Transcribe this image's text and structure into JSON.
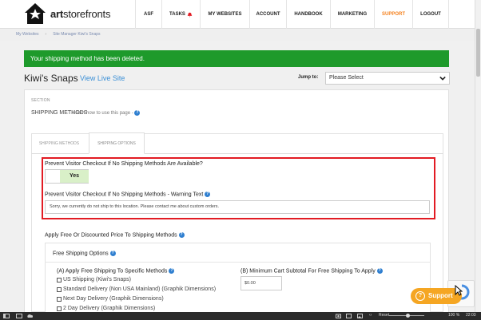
{
  "header": {
    "logo_bold": "art",
    "logo_rest": "storefronts",
    "nav": [
      "ASF",
      "TASKS",
      "MY WEBSITES",
      "ACCOUNT",
      "HANDBOOK",
      "MARKETING",
      "SUPPORT",
      "LOGOUT"
    ]
  },
  "breadcrumb": [
    "My Websites",
    "Site Manager Kiwi's Snaps"
  ],
  "alert": "Your shipping method has been deleted.",
  "site": {
    "title": "Kiwi's Snaps",
    "view_live": "View Live Site",
    "jump_label": "Jump to:",
    "jump_value": "Please Select"
  },
  "section": {
    "label": "SECTION",
    "title": "SHIPPING METHODS",
    "learn": "Learn how to use this page -"
  },
  "tabs": [
    "SHIPPING METHODS",
    "SHIPPING OPTIONS"
  ],
  "prevent": {
    "question": "Prevent Visitor Checkout If No Shipping Methods Are Available?",
    "toggle_value": "Yes",
    "warning_label": "Prevent Visitor Checkout If No Shipping Methods - Warning Text",
    "warning_text": "Sorry, we currently do not ship to this location.  Please contact me about custom orders."
  },
  "apply": {
    "title": "Apply Free Or Discounted Price To Shipping Methods",
    "free_title": "Free Shipping Options",
    "col_a": "(A) Apply Free Shipping To Specific Methods",
    "col_b": "(B) Minimum Cart Subtotal For Free Shipping To Apply",
    "subtotal_value": "$0.00",
    "methods": [
      "US Shipping (Kiwi's Snaps)",
      "Standard Delivery (Non USA Mainland) (Graphik Dimensions)",
      "Next Day Delivery (Graphik Dimensions)",
      "2 Day Delivery (Graphik Dimensions)"
    ]
  },
  "support_button": "Support",
  "taskbar": {
    "reset": "Reset",
    "zoom": "100 %",
    "time": "22:03"
  },
  "colors": {
    "alert_green": "#1e9a2b",
    "accent_orange": "#f5821f",
    "highlight_red": "#e21b23",
    "link_blue": "#3a8fd6"
  }
}
